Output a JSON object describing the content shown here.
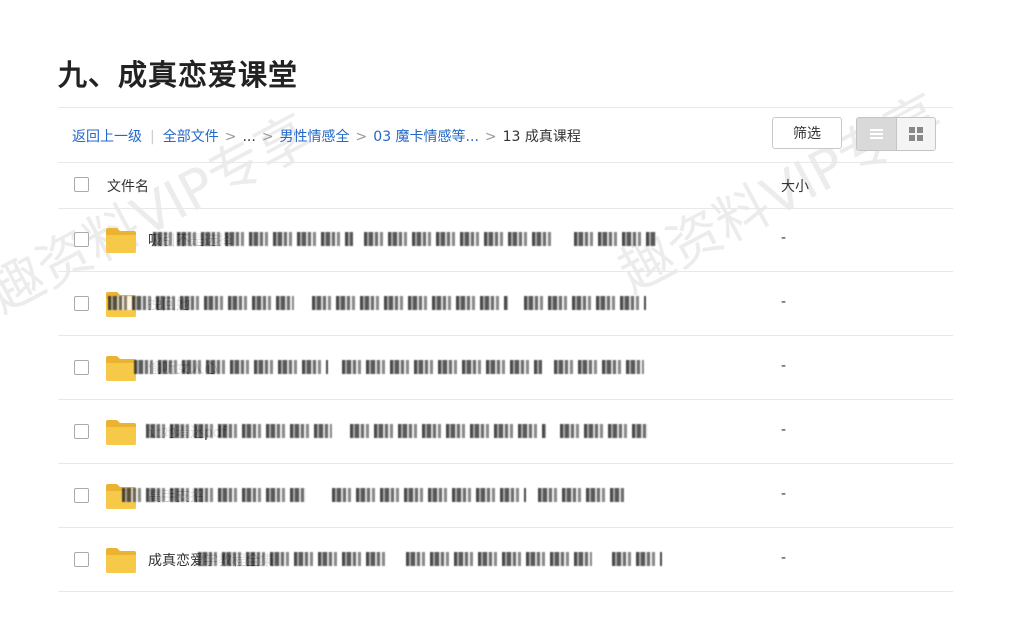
{
  "page": {
    "title": "九、成真恋爱课堂"
  },
  "watermark": {
    "text": "趣资料VIP专享"
  },
  "breadcrumb": {
    "back": "返回上一级",
    "all_files": "全部文件",
    "ellipsis": "...",
    "level1": "男性情感全",
    "level2": "03 魔卡情感等...",
    "current": "13 成真课程",
    "separator": ">"
  },
  "toolbar": {
    "filter_label": "筛选",
    "list_view_icon": "list-icon",
    "grid_view_icon": "grid-icon"
  },
  "table": {
    "headers": {
      "name": "文件名",
      "size": "大小"
    },
    "rows": [
      {
        "name": "吸引不是选择",
        "size": "-"
      },
      {
        "name": "挽回她",
        "size": "-"
      },
      {
        "name": "偷听女人心",
        "size": "-"
      },
      {
        "name": "让她着迷pdf",
        "size": "-"
      },
      {
        "name": "高手支招",
        "size": "-"
      },
      {
        "name": "成真恋爱学教程全集",
        "size": "-"
      }
    ]
  },
  "colors": {
    "link": "#2468c8",
    "folder": "#f7c948"
  }
}
